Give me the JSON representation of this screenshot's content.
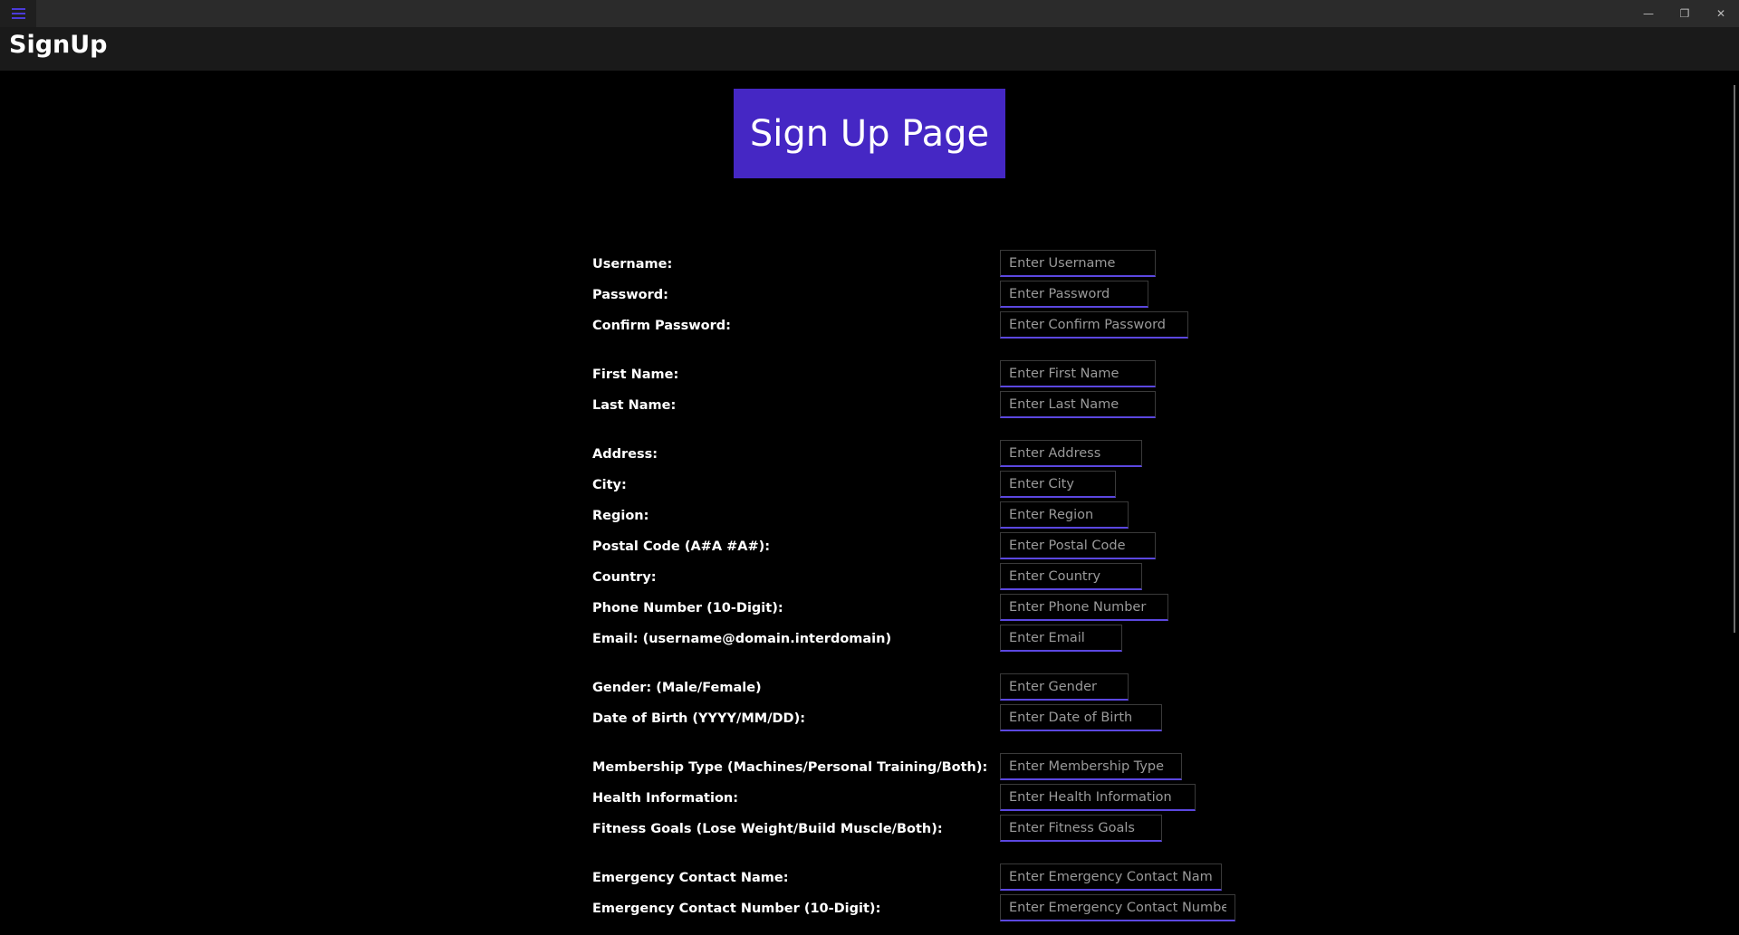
{
  "window": {
    "controls": {
      "minimize": "—",
      "restore": "❐",
      "close": "✕"
    }
  },
  "app": {
    "title": "SignUp"
  },
  "banner": {
    "text": "Sign Up Page"
  },
  "fields": [
    {
      "label": "Username:",
      "placeholder": "Enter Username"
    },
    {
      "label": "Password:",
      "placeholder": "Enter Password"
    },
    {
      "label": "Confirm Password:",
      "placeholder": "Enter Confirm Password"
    },
    {
      "label": "First Name:",
      "placeholder": "Enter First Name"
    },
    {
      "label": "Last Name:",
      "placeholder": "Enter Last Name"
    },
    {
      "label": "Address:",
      "placeholder": "Enter Address"
    },
    {
      "label": "City:",
      "placeholder": "Enter City"
    },
    {
      "label": "Region:",
      "placeholder": "Enter Region"
    },
    {
      "label": "Postal Code (A#A #A#):",
      "placeholder": "Enter Postal Code"
    },
    {
      "label": "Country:",
      "placeholder": "Enter Country"
    },
    {
      "label": "Phone Number (10-Digit):",
      "placeholder": "Enter Phone Number"
    },
    {
      "label": "Email: (username@domain.interdomain)",
      "placeholder": "Enter Email"
    },
    {
      "label": "Gender: (Male/Female)",
      "placeholder": "Enter Gender"
    },
    {
      "label": "Date of Birth (YYYY/MM/DD):",
      "placeholder": "Enter Date of Birth"
    },
    {
      "label": "Membership Type (Machines/Personal Training/Both):",
      "placeholder": "Enter Membership Type"
    },
    {
      "label": "Health Information:",
      "placeholder": "Enter Health Information"
    },
    {
      "label": "Fitness Goals (Lose Weight/Build Muscle/Both):",
      "placeholder": "Enter Fitness Goals"
    },
    {
      "label": "Emergency Contact Name:",
      "placeholder": "Enter Emergency Contact Name"
    },
    {
      "label": "Emergency Contact Number (10-Digit):",
      "placeholder": "Enter Emergency Contact Number"
    }
  ],
  "colors": {
    "accent": "#4527c4",
    "field_underline": "#5b47e0",
    "background": "#000000"
  }
}
